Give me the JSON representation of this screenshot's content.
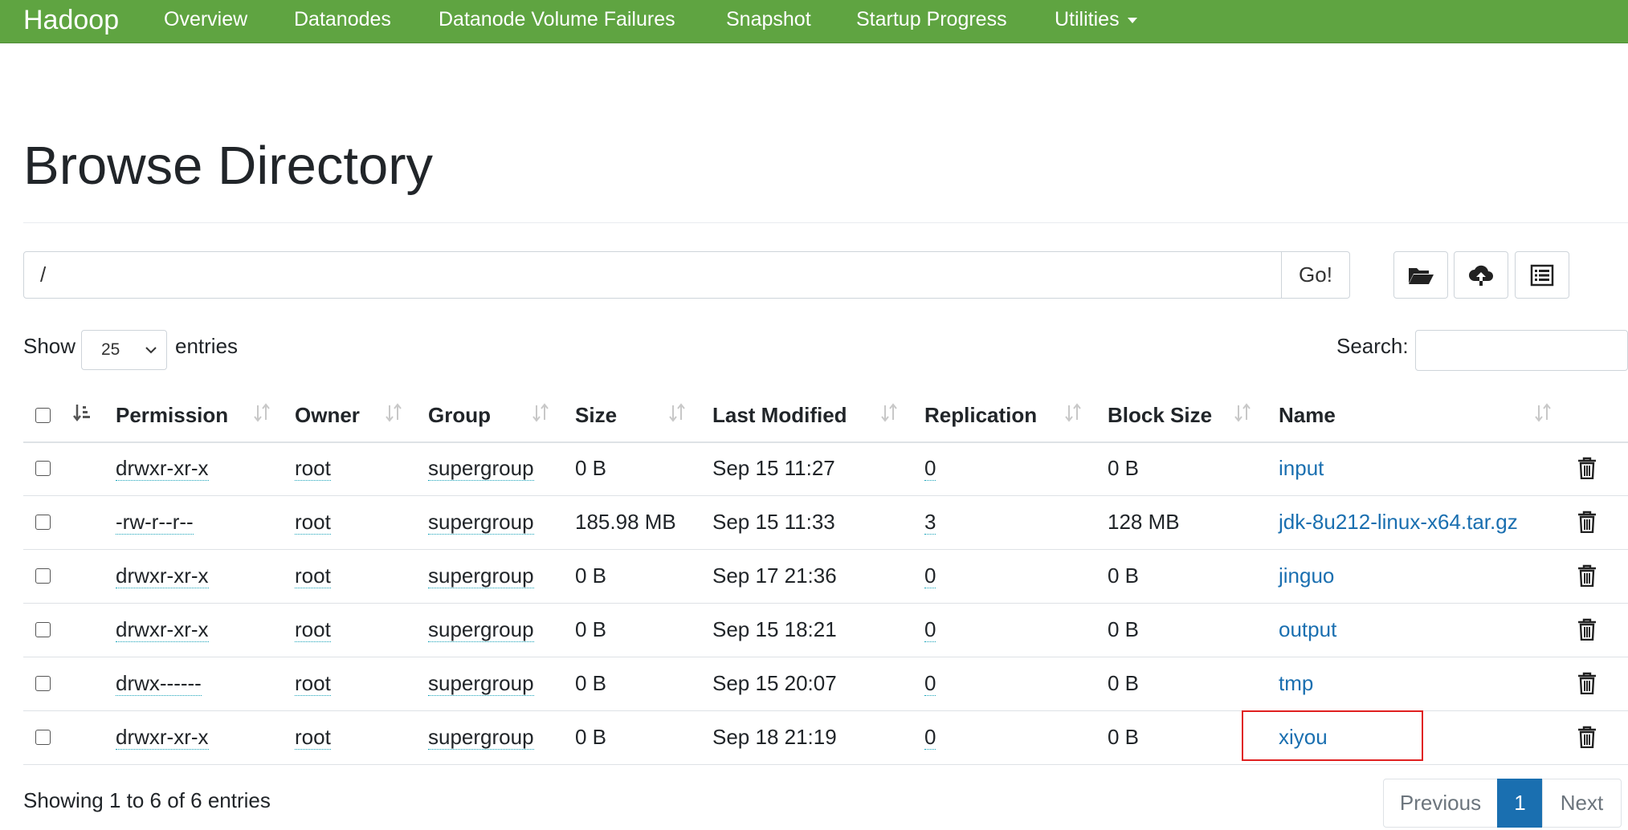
{
  "navbar": {
    "brand": "Hadoop",
    "items": [
      "Overview",
      "Datanodes",
      "Datanode Volume Failures",
      "Snapshot",
      "Startup Progress",
      "Utilities"
    ]
  },
  "page": {
    "title": "Browse Directory"
  },
  "path_bar": {
    "value": "/",
    "go_label": "Go!"
  },
  "toolbar": {
    "icons": [
      "folder-open-icon",
      "cloud-upload-icon",
      "list-alt-icon"
    ]
  },
  "length": {
    "show_label": "Show",
    "value": "25",
    "entries_label": "entries"
  },
  "search": {
    "label": "Search:",
    "value": ""
  },
  "table": {
    "columns": [
      "Permission",
      "Owner",
      "Group",
      "Size",
      "Last Modified",
      "Replication",
      "Block Size",
      "Name"
    ],
    "rows": [
      {
        "permission": "drwxr-xr-x",
        "owner": "root",
        "group": "supergroup",
        "size": "0 B",
        "modified": "Sep 15 11:27",
        "replication": "0",
        "block_size": "0 B",
        "name": "input"
      },
      {
        "permission": "-rw-r--r--",
        "owner": "root",
        "group": "supergroup",
        "size": "185.98 MB",
        "modified": "Sep 15 11:33",
        "replication": "3",
        "block_size": "128 MB",
        "name": "jdk-8u212-linux-x64.tar.gz"
      },
      {
        "permission": "drwxr-xr-x",
        "owner": "root",
        "group": "supergroup",
        "size": "0 B",
        "modified": "Sep 17 21:36",
        "replication": "0",
        "block_size": "0 B",
        "name": "jinguo"
      },
      {
        "permission": "drwxr-xr-x",
        "owner": "root",
        "group": "supergroup",
        "size": "0 B",
        "modified": "Sep 15 18:21",
        "replication": "0",
        "block_size": "0 B",
        "name": "output"
      },
      {
        "permission": "drwx------",
        "owner": "root",
        "group": "supergroup",
        "size": "0 B",
        "modified": "Sep 15 20:07",
        "replication": "0",
        "block_size": "0 B",
        "name": "tmp"
      },
      {
        "permission": "drwxr-xr-x",
        "owner": "root",
        "group": "supergroup",
        "size": "0 B",
        "modified": "Sep 18 21:19",
        "replication": "0",
        "block_size": "0 B",
        "name": "xiyou"
      }
    ]
  },
  "footer": {
    "info": "Showing 1 to 6 of 6 entries",
    "previous": "Previous",
    "current_page": "1",
    "next": "Next"
  },
  "colors": {
    "navbar": "#5fa441",
    "link": "#1a6fb0",
    "active_page": "#1a6fb0",
    "highlight": "#e02020"
  }
}
